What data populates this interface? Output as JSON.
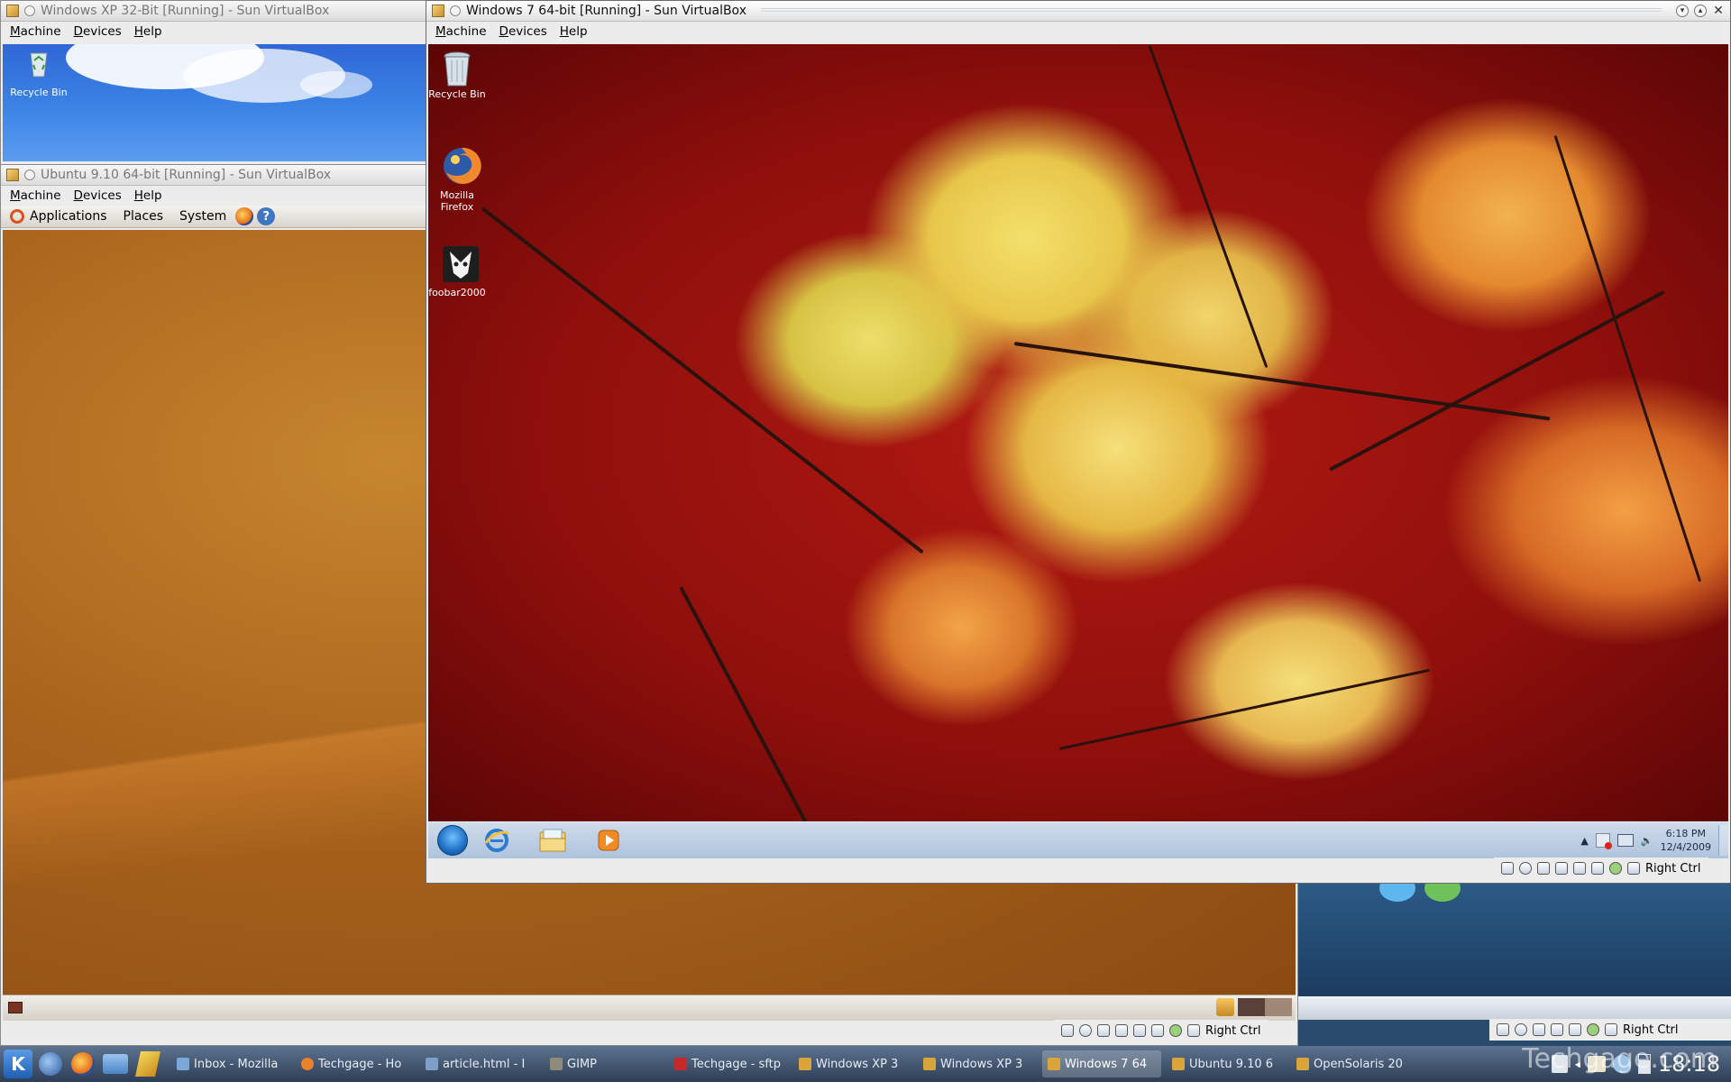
{
  "xp_window": {
    "title": "Windows XP 32-Bit [Running] - Sun VirtualBox",
    "menu": [
      "Machine",
      "Devices",
      "Help"
    ],
    "desktop_icons": [
      {
        "label": "Recycle Bin"
      }
    ]
  },
  "ubuntu_window": {
    "title": "Ubuntu 9.10 64-bit [Running] - Sun VirtualBox",
    "menu": [
      "Machine",
      "Devices",
      "Help"
    ],
    "panel": {
      "applications": "Applications",
      "places": "Places",
      "system": "System"
    },
    "status_host_key": "Right Ctrl"
  },
  "win7_window": {
    "title": "Windows 7 64-bit [Running] - Sun VirtualBox",
    "menu": [
      "Machine",
      "Devices",
      "Help"
    ],
    "desktop_icons": [
      {
        "label": "Recycle Bin",
        "icon": "recycle-bin-icon"
      },
      {
        "label": "Mozilla Firefox",
        "icon": "firefox-icon"
      },
      {
        "label": "foobar2000",
        "icon": "foobar2000-icon"
      }
    ],
    "taskbar": {
      "time": "6:18 PM",
      "date": "12/4/2009"
    },
    "status_host_key": "Right Ctrl"
  },
  "opensolaris_window": {
    "status_host_key": "Right Ctrl"
  },
  "kde_taskbar": {
    "tasks": [
      {
        "label": "Inbox - Mozilla",
        "active": false
      },
      {
        "label": "Techgage - Ho",
        "active": false
      },
      {
        "label": "article.html - I",
        "active": false
      },
      {
        "label": "GIMP",
        "active": false
      },
      {
        "label": "Techgage - sftp",
        "active": false
      },
      {
        "label": "Windows XP 3",
        "active": false
      },
      {
        "label": "Windows XP 3",
        "active": false
      },
      {
        "label": "Windows 7 64",
        "active": true
      },
      {
        "label": "Ubuntu 9.10 6",
        "active": false
      },
      {
        "label": "OpenSolaris 20",
        "active": false
      }
    ],
    "clock": "18:18"
  },
  "watermark": "Techgage.com"
}
